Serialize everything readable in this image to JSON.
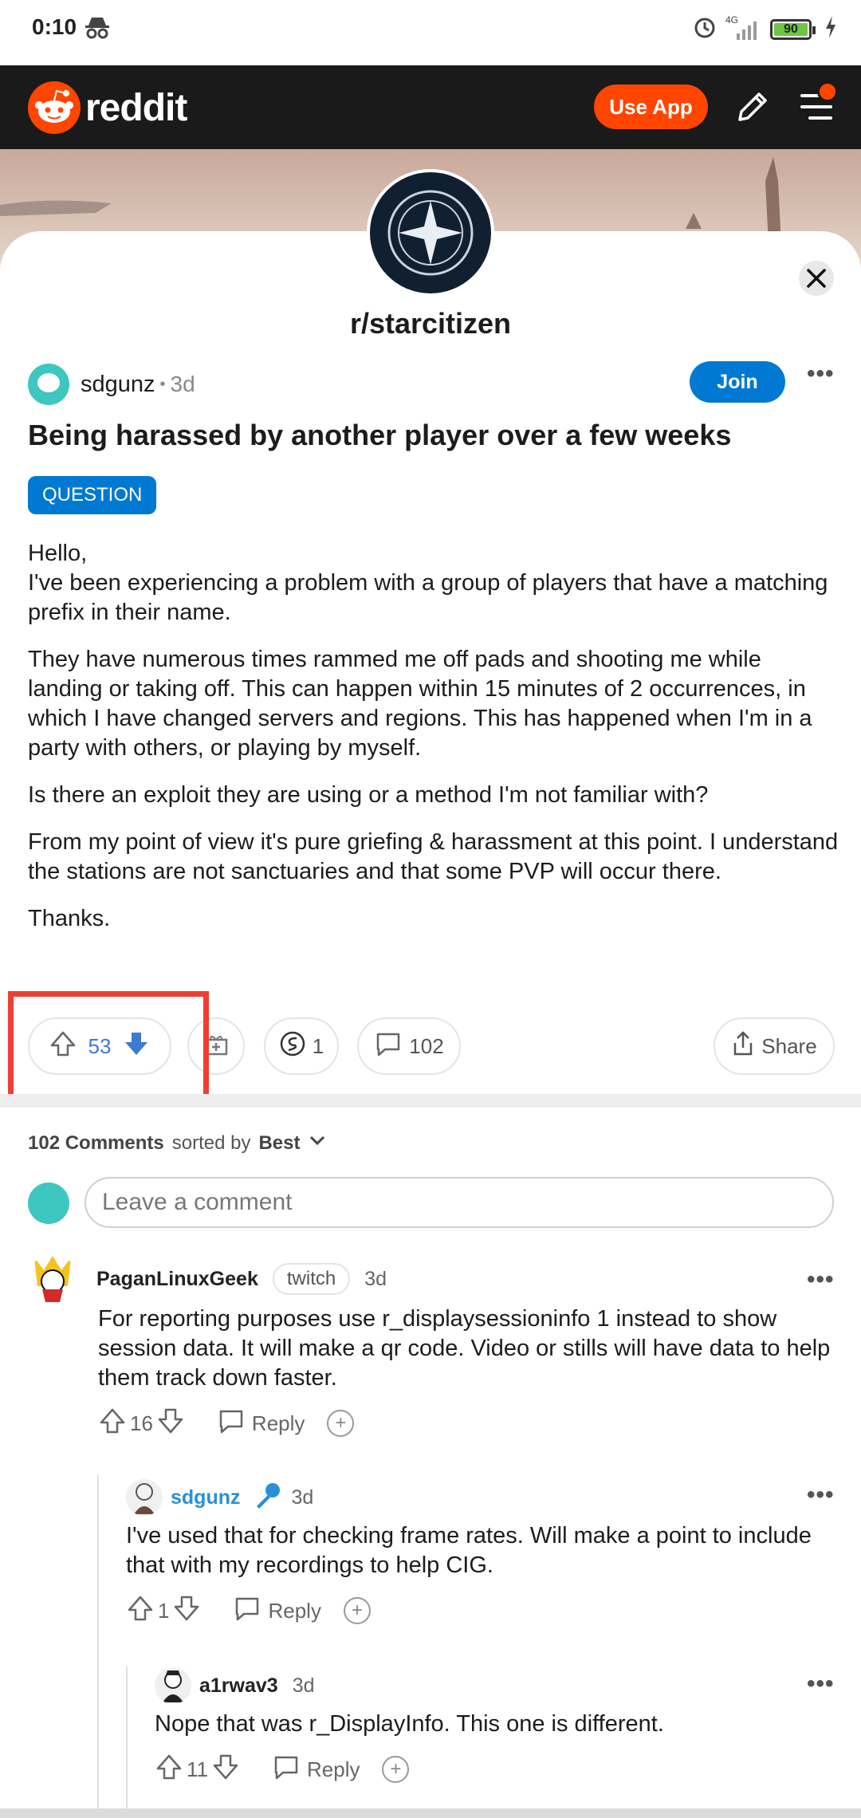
{
  "status": {
    "time": "0:10",
    "network": "4G",
    "battery": "90"
  },
  "header": {
    "brand": "reddit",
    "use_app": "Use App"
  },
  "subreddit": {
    "name": "r/starcitizen"
  },
  "post": {
    "author": "sdgunz",
    "age": "3d",
    "join_label": "Join",
    "title": "Being harassed by another player over a few weeks",
    "flair": "QUESTION",
    "body": [
      "Hello,\nI've been experiencing a problem with a group of players that have a matching prefix in their name.",
      "They have numerous times rammed me off pads and shooting me while landing or taking off. This can happen within 15 minutes of 2 occurrences, in which I have changed servers and regions. This has happened when I'm in a party with others, or playing by myself.",
      "Is there an exploit they are using or a method I'm not familiar with?",
      "From my point of view it's pure griefing & harassment at this point. I understand the stations are not sanctuaries and that some PVP will occur there.",
      "Thanks."
    ],
    "score": "53",
    "awards": "1",
    "comments": "102",
    "share_label": "Share"
  },
  "comments_header": {
    "count_label": "102 Comments",
    "sorted_by": "sorted by",
    "sort": "Best"
  },
  "comment_box": {
    "placeholder": "Leave a comment"
  },
  "comments": [
    {
      "author": "PaganLinuxGeek",
      "flair": "twitch",
      "age": "3d",
      "body": "For reporting purposes use r_displaysessioninfo 1 instead to show session data. It will make a qr code. Video or stills will have data to help them track down faster.",
      "score": "16",
      "reply_label": "Reply"
    },
    {
      "author": "sdgunz",
      "age": "3d",
      "body": "I've used that for checking frame rates. Will make a point to include that with my recordings to help CIG.",
      "score": "1",
      "reply_label": "Reply"
    },
    {
      "author": "a1rwav3",
      "age": "3d",
      "body": "Nope that was r_DisplayInfo. This one is different.",
      "score": "11",
      "reply_label": "Reply"
    }
  ],
  "colors": {
    "brand": "#ff4500",
    "header_bg": "#1a1a1b",
    "join": "#0079d3",
    "score": "#3d7ad1",
    "highlight": "#ef3e33",
    "op_name": "#2a8fd6"
  },
  "icons": [
    "incognito-icon",
    "alarm-icon",
    "signal-icon",
    "battery-icon",
    "charging-icon",
    "reddit-logo-icon",
    "pencil-icon",
    "menu-icon",
    "close-icon",
    "more-icon",
    "upvote-icon",
    "downvote-icon",
    "gift-icon",
    "award-icon",
    "comment-icon",
    "share-icon",
    "chevron-down-icon",
    "reply-icon",
    "mic-icon"
  ]
}
